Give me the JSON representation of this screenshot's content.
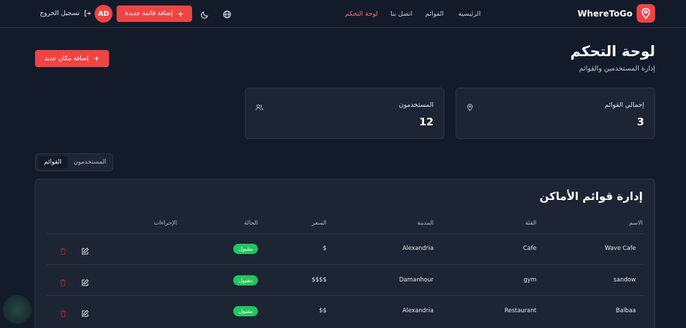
{
  "nav": {
    "brand": "WhereToGo",
    "links": [
      "الرئيسية",
      "القوائم",
      "اتصل بنا",
      "لوحة التحكم"
    ],
    "add_list_label": "إضافة قائمة جديدة",
    "avatar": "AD",
    "logout_label": "تسجيل الخروج"
  },
  "header": {
    "title": "لوحة التحكم",
    "subtitle": "إدارة المستخدمين والقوائم",
    "add_place_label": "إضافة مكان جديد"
  },
  "stats": [
    {
      "label": "إجمالي القوائم",
      "value": "3",
      "icon": "map-pin-icon"
    },
    {
      "label": "المستخدمون",
      "value": "12",
      "icon": "users-icon"
    }
  ],
  "tabs": {
    "lists": "القوائم",
    "users": "المستخدمون"
  },
  "table": {
    "title": "إدارة قوائم الأماكن",
    "headers": {
      "name": "الاسم",
      "category": "الفئة",
      "city": "المدينة",
      "price": "السعر",
      "status": "الحالة",
      "actions": "الإجراءات"
    },
    "rows": [
      {
        "name": "Wave Cafe",
        "category": "Cafe",
        "city": "Alexandria",
        "price": "$",
        "status": "مقبول"
      },
      {
        "name": "sandow",
        "category": "gym",
        "city": "Damanhour",
        "price": "$$$$",
        "status": "مقبول"
      },
      {
        "name": "Balbaa",
        "category": "Restaurant",
        "city": "Alexandria",
        "price": "$$",
        "status": "مقبول"
      }
    ]
  },
  "colors": {
    "accent": "#ef4444",
    "success": "#22c55e",
    "background": "#131b2b",
    "card": "#1d2534"
  }
}
